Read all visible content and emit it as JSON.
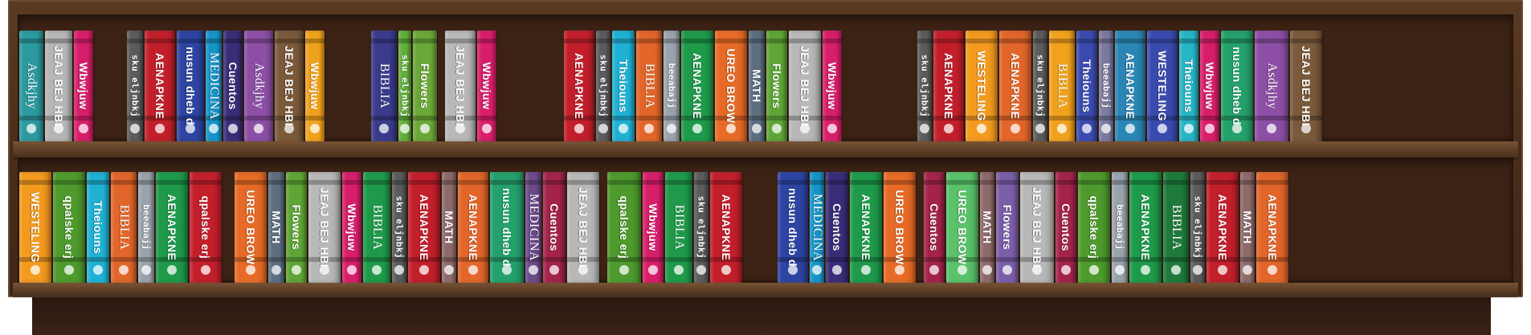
{
  "scene": {
    "description_label": "",
    "colors": {
      "wood": "#5a3a23",
      "cavity": "#3b2214",
      "base": "#2a1810"
    }
  },
  "shelves": [
    {
      "books": [
        {
          "title": "Asdkjhy",
          "color": "#2b9a9f",
          "w": 32,
          "h": 118,
          "font": "serif"
        },
        {
          "title": "JEAJ BEJ HBI",
          "color": "#b6b6b6",
          "w": 36,
          "h": 118,
          "font": "sans"
        },
        {
          "title": "Wbwjuw",
          "color": "#d81e6a",
          "w": 26,
          "h": 118,
          "font": "sans"
        },
        {
          "title": "",
          "color": "#000000",
          "w": 40,
          "h": 0,
          "font": "gap"
        },
        {
          "title": "sku eljnbkj",
          "color": "#5b5b5b",
          "w": 22,
          "h": 118,
          "font": "mono"
        },
        {
          "title": "AENAPKNE",
          "color": "#c31f2b",
          "w": 40,
          "h": 118,
          "font": "sans"
        },
        {
          "title": "nusun dheb d",
          "color": "#2d44a3",
          "w": 36,
          "h": 118,
          "font": "sans"
        },
        {
          "title": "MEDICINA",
          "color": "#1594c8",
          "w": 22,
          "h": 118,
          "font": "serif"
        },
        {
          "title": "Cuentos",
          "color": "#3a2d78",
          "w": 26,
          "h": 118,
          "font": "sans"
        },
        {
          "title": "Asdkjhy",
          "color": "#8c4fa5",
          "w": 38,
          "h": 118,
          "font": "serif"
        },
        {
          "title": "JEAJ BEJ HBI",
          "color": "#7a5a3a",
          "w": 38,
          "h": 118,
          "font": "sans"
        },
        {
          "title": "Wbwjuw",
          "color": "#f1a21c",
          "w": 26,
          "h": 118,
          "font": "sans"
        },
        {
          "title": "",
          "color": "#000000",
          "w": 56,
          "h": 0,
          "font": "gap"
        },
        {
          "title": "BIBLIA",
          "color": "#3a3b8c",
          "w": 34,
          "h": 118,
          "font": "serif"
        },
        {
          "title": "sku eljnbkj",
          "color": "#5fae3a",
          "w": 18,
          "h": 118,
          "font": "mono"
        },
        {
          "title": "Flowers",
          "color": "#6aa837",
          "w": 32,
          "h": 118,
          "font": "sans"
        },
        {
          "title": "",
          "color": "#000000",
          "w": 8,
          "h": 0,
          "font": "gap"
        },
        {
          "title": "JEAJ BEJ HBI",
          "color": "#b8b8b8",
          "w": 40,
          "h": 118,
          "font": "sans"
        },
        {
          "title": "Wbwjuw",
          "color": "#d81e6a",
          "w": 26,
          "h": 118,
          "font": "sans"
        },
        {
          "title": "",
          "color": "#000000",
          "w": 82,
          "h": 0,
          "font": "gap"
        },
        {
          "title": "AENAPKNE",
          "color": "#c31f2b",
          "w": 40,
          "h": 118,
          "font": "sans"
        },
        {
          "title": "sku eljnbkj",
          "color": "#5b5b5b",
          "w": 20,
          "h": 118,
          "font": "mono"
        },
        {
          "title": "Theiouns",
          "color": "#1fb1d3",
          "w": 30,
          "h": 118,
          "font": "sans"
        },
        {
          "title": "BIBLIA",
          "color": "#e2662a",
          "w": 34,
          "h": 118,
          "font": "serif"
        },
        {
          "title": "beeabajj",
          "color": "#9aa3ad",
          "w": 22,
          "h": 118,
          "font": "mono"
        },
        {
          "title": "AENAPKNE",
          "color": "#1e9a4a",
          "w": 42,
          "h": 118,
          "font": "sans"
        },
        {
          "title": "UREO BROW",
          "color": "#e76b26",
          "w": 42,
          "h": 118,
          "font": "sans"
        },
        {
          "title": "MATH",
          "color": "#5c6e80",
          "w": 22,
          "h": 118,
          "font": "sans"
        },
        {
          "title": "Flowers",
          "color": "#5ea536",
          "w": 28,
          "h": 118,
          "font": "sans"
        },
        {
          "title": "JEAJ BEJ HBI",
          "color": "#b8b8b8",
          "w": 42,
          "h": 118,
          "font": "sans"
        },
        {
          "title": "Wbwjuw",
          "color": "#d81e6a",
          "w": 26,
          "h": 118,
          "font": "sans"
        },
        {
          "title": "",
          "color": "#000000",
          "w": 92,
          "h": 0,
          "font": "gap"
        },
        {
          "title": "sku eljnbkj",
          "color": "#5b5b5b",
          "w": 20,
          "h": 118,
          "font": "mono"
        },
        {
          "title": "AENAPKNE",
          "color": "#c31f2b",
          "w": 40,
          "h": 118,
          "font": "sans"
        },
        {
          "title": "WESTELING",
          "color": "#f39a1f",
          "w": 42,
          "h": 118,
          "font": "sans"
        },
        {
          "title": "AENAPKNE",
          "color": "#e2662a",
          "w": 42,
          "h": 118,
          "font": "sans"
        },
        {
          "title": "sku eljnbkj",
          "color": "#5b5b5b",
          "w": 20,
          "h": 118,
          "font": "mono"
        },
        {
          "title": "BIBLIA",
          "color": "#f1a21c",
          "w": 34,
          "h": 118,
          "font": "serif"
        },
        {
          "title": "Theiouns",
          "color": "#3a4bb0",
          "w": 28,
          "h": 118,
          "font": "sans"
        },
        {
          "title": "beeabajj",
          "color": "#7a7aa0",
          "w": 20,
          "h": 118,
          "font": "mono"
        },
        {
          "title": "AENAPKNE",
          "color": "#2b86b5",
          "w": 40,
          "h": 118,
          "font": "sans"
        },
        {
          "title": "WESTELING",
          "color": "#3a4bb0",
          "w": 40,
          "h": 118,
          "font": "sans"
        },
        {
          "title": "Theiouns",
          "color": "#25b5c6",
          "w": 26,
          "h": 118,
          "font": "sans"
        },
        {
          "title": "Wbwjuw",
          "color": "#d81e6a",
          "w": 26,
          "h": 118,
          "font": "sans"
        },
        {
          "title": "nusun dheb d",
          "color": "#24a16b",
          "w": 42,
          "h": 118,
          "font": "sans"
        },
        {
          "title": "Asdkjhy",
          "color": "#8c4fa5",
          "w": 44,
          "h": 118,
          "font": "serif"
        },
        {
          "title": "JEAJ BEJ HBI",
          "color": "#7a5a3a",
          "w": 42,
          "h": 118,
          "font": "sans"
        }
      ]
    },
    {
      "books": [
        {
          "title": "WESTELING",
          "color": "#f39a1f",
          "w": 42,
          "h": 118,
          "font": "sans"
        },
        {
          "title": "qpalske erj",
          "color": "#4e9a2d",
          "w": 42,
          "h": 118,
          "font": "sans"
        },
        {
          "title": "Theiouns",
          "color": "#1fb1d3",
          "w": 30,
          "h": 118,
          "font": "sans"
        },
        {
          "title": "BIBLIA",
          "color": "#e2662a",
          "w": 34,
          "h": 118,
          "font": "serif"
        },
        {
          "title": "beeabajj",
          "color": "#9aa3ad",
          "w": 22,
          "h": 118,
          "font": "mono"
        },
        {
          "title": "AENAPKNE",
          "color": "#1e9a4a",
          "w": 42,
          "h": 118,
          "font": "sans"
        },
        {
          "title": "qpalske erj",
          "color": "#c31f2b",
          "w": 42,
          "h": 118,
          "font": "sans"
        },
        {
          "title": "",
          "color": "#000000",
          "w": 14,
          "h": 0,
          "font": "gap"
        },
        {
          "title": "UREO BROW",
          "color": "#e76b26",
          "w": 42,
          "h": 118,
          "font": "sans"
        },
        {
          "title": "MATH",
          "color": "#5c6e80",
          "w": 22,
          "h": 118,
          "font": "sans"
        },
        {
          "title": "Flowers",
          "color": "#5ea536",
          "w": 28,
          "h": 118,
          "font": "sans"
        },
        {
          "title": "JEAJ BEJ HBI",
          "color": "#b8b8b8",
          "w": 42,
          "h": 118,
          "font": "sans"
        },
        {
          "title": "Wbwjuw",
          "color": "#d81e6a",
          "w": 26,
          "h": 118,
          "font": "sans"
        },
        {
          "title": "BIBLIA",
          "color": "#1e9a4a",
          "w": 36,
          "h": 118,
          "font": "serif"
        },
        {
          "title": "sku eljnbkj",
          "color": "#5b5b5b",
          "w": 20,
          "h": 118,
          "font": "mono"
        },
        {
          "title": "AENAPKNE",
          "color": "#c31f2b",
          "w": 42,
          "h": 118,
          "font": "sans"
        },
        {
          "title": "MATH",
          "color": "#8e6a6a",
          "w": 20,
          "h": 118,
          "font": "sans"
        },
        {
          "title": "AENAPKNE",
          "color": "#e2662a",
          "w": 40,
          "h": 118,
          "font": "sans"
        },
        {
          "title": "nusun dheb d",
          "color": "#24a16b",
          "w": 44,
          "h": 118,
          "font": "sans"
        },
        {
          "title": "MEDICINA",
          "color": "#6b4a8a",
          "w": 22,
          "h": 118,
          "font": "serif"
        },
        {
          "title": "Cuentos",
          "color": "#a3234b",
          "w": 30,
          "h": 118,
          "font": "sans"
        },
        {
          "title": "JEAJ BEJ HBI",
          "color": "#b8b8b8",
          "w": 42,
          "h": 118,
          "font": "sans"
        },
        {
          "title": "",
          "color": "#000000",
          "w": 8,
          "h": 0,
          "font": "gap"
        },
        {
          "title": "qpalske erj",
          "color": "#4e9a2d",
          "w": 44,
          "h": 118,
          "font": "sans"
        },
        {
          "title": "Wbwjuw",
          "color": "#d81e6a",
          "w": 28,
          "h": 118,
          "font": "sans"
        },
        {
          "title": "BIBLIA",
          "color": "#1e9a4a",
          "w": 36,
          "h": 118,
          "font": "serif"
        },
        {
          "title": "sku eljnbkj",
          "color": "#5b5b5b",
          "w": 20,
          "h": 118,
          "font": "mono"
        },
        {
          "title": "AENAPKNE",
          "color": "#c31f2b",
          "w": 42,
          "h": 118,
          "font": "sans"
        },
        {
          "title": "",
          "color": "#000000",
          "w": 42,
          "h": 0,
          "font": "gap"
        },
        {
          "title": "nusun dheb d",
          "color": "#2d44a3",
          "w": 40,
          "h": 118,
          "font": "sans"
        },
        {
          "title": "MEDICINA",
          "color": "#1594c8",
          "w": 20,
          "h": 118,
          "font": "serif"
        },
        {
          "title": "Cuentos",
          "color": "#3a2d78",
          "w": 30,
          "h": 118,
          "font": "sans"
        },
        {
          "title": "AENAPKNE",
          "color": "#1e9a4a",
          "w": 42,
          "h": 118,
          "font": "sans"
        },
        {
          "title": "UREO BROW",
          "color": "#e76b26",
          "w": 42,
          "h": 118,
          "font": "sans"
        },
        {
          "title": "",
          "color": "#000000",
          "w": 8,
          "h": 0,
          "font": "gap"
        },
        {
          "title": "Cuentos",
          "color": "#a3234b",
          "w": 28,
          "h": 118,
          "font": "sans"
        },
        {
          "title": "UREO BROW",
          "color": "#5ac26a",
          "w": 42,
          "h": 118,
          "font": "sans"
        },
        {
          "title": "MATH",
          "color": "#8e6a6a",
          "w": 20,
          "h": 118,
          "font": "sans"
        },
        {
          "title": "Flowers",
          "color": "#7b5ea8",
          "w": 30,
          "h": 118,
          "font": "sans"
        },
        {
          "title": "JEAJ BEJ HBI",
          "color": "#b8b8b8",
          "w": 44,
          "h": 118,
          "font": "sans"
        },
        {
          "title": "Cuentos",
          "color": "#a3234b",
          "w": 28,
          "h": 118,
          "font": "sans"
        },
        {
          "title": "qpalske erj",
          "color": "#4e9a2d",
          "w": 42,
          "h": 118,
          "font": "sans"
        },
        {
          "title": "beeabajj",
          "color": "#9aa3ad",
          "w": 22,
          "h": 118,
          "font": "mono"
        },
        {
          "title": "AENAPKNE",
          "color": "#1e9a4a",
          "w": 42,
          "h": 118,
          "font": "sans"
        },
        {
          "title": "BIBLIA",
          "color": "#1e7a3a",
          "w": 34,
          "h": 118,
          "font": "serif"
        },
        {
          "title": "sku eljnbkj",
          "color": "#5b5b5b",
          "w": 20,
          "h": 118,
          "font": "mono"
        },
        {
          "title": "AENAPKNE",
          "color": "#c31f2b",
          "w": 42,
          "h": 118,
          "font": "sans"
        },
        {
          "title": "MATH",
          "color": "#8e6a6a",
          "w": 20,
          "h": 118,
          "font": "sans"
        },
        {
          "title": "AENAPKNE",
          "color": "#e2662a",
          "w": 42,
          "h": 118,
          "font": "sans"
        }
      ]
    }
  ]
}
